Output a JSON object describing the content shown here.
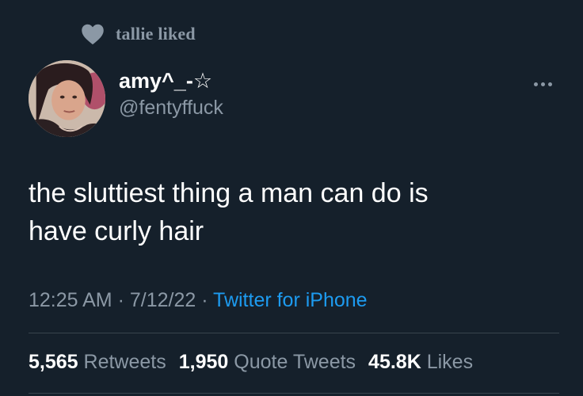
{
  "social_context": {
    "icon": "heart-icon",
    "text": "tallie liked"
  },
  "author": {
    "display_name": "amy^_-☆",
    "handle": "@fentyffuck"
  },
  "tweet": {
    "text_line1": "the sluttiest thing a man can do is",
    "text_line2": "have curly hair"
  },
  "meta": {
    "time": "12:25 AM",
    "sep1": " · ",
    "date": "7/12/22",
    "sep2": " · ",
    "source": "Twitter for iPhone"
  },
  "stats": {
    "retweets_count": "5,565",
    "retweets_label": "Retweets",
    "quotes_count": "1,950",
    "quotes_label": "Quote Tweets",
    "likes_count": "45.8K",
    "likes_label": "Likes"
  },
  "colors": {
    "background": "#15202b",
    "primary_text": "#ffffff",
    "secondary_text": "#8b98a5",
    "link": "#1d9bf0",
    "divider": "#38444d"
  }
}
